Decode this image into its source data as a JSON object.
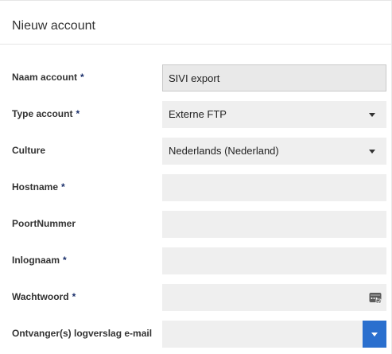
{
  "header": {
    "title": "Nieuw account"
  },
  "required_marker": "*",
  "fields": {
    "naam_account": {
      "label": "Naam account",
      "value": "SIVI export"
    },
    "type_account": {
      "label": "Type account",
      "value": "Externe FTP"
    },
    "culture": {
      "label": "Culture",
      "value": "Nederlands (Nederland)"
    },
    "hostname": {
      "label": "Hostname",
      "value": ""
    },
    "poortnummer": {
      "label": "PoortNummer",
      "value": ""
    },
    "inlognaam": {
      "label": "Inlognaam",
      "value": ""
    },
    "wachtwoord": {
      "label": "Wachtwoord",
      "value": "",
      "icon": "password-generator-icon"
    },
    "ontvangers": {
      "label": "Ontvanger(s) logverslag e-mail",
      "value": "",
      "icon": "chevron-down-icon"
    }
  },
  "colors": {
    "accent": "#2a6fce",
    "required": "#1a2f6b",
    "field_bg": "#efefef",
    "readonly_bg": "#e9e9e9"
  }
}
